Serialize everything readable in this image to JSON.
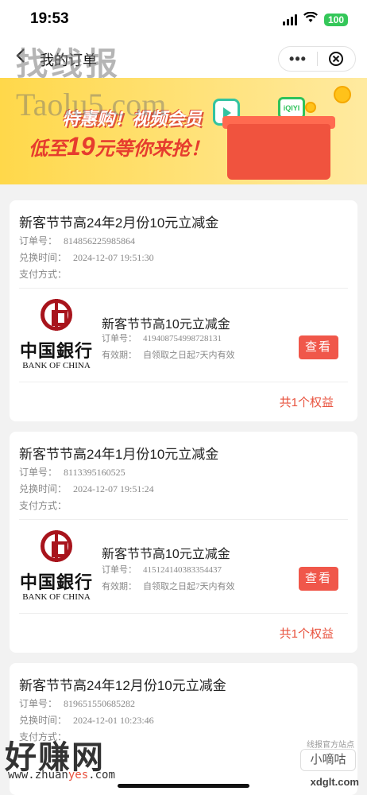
{
  "status": {
    "time": "19:53",
    "battery": "100"
  },
  "nav": {
    "title": "我的订单"
  },
  "watermarks": {
    "top": "找线报",
    "url": "Taolu5.com",
    "bottom": "好赚网",
    "bottom_url_a": "www.zhuan",
    "bottom_url_b": "yes",
    "bottom_url_c": ".com",
    "corner_small": "线报官方站点",
    "corner_box": "小嘀咕",
    "corner_url": "xdglt.com"
  },
  "banner": {
    "line1": "特惠购！视频会员",
    "line2_pre": "低至",
    "line2_num": "19",
    "line2_post": "元等你来抢！",
    "iqiyi": "iQIYI"
  },
  "labels": {
    "order_no": "订单号：",
    "exchange_time": "兑换时间：",
    "pay_method": "支付方式：",
    "coupon_no": "订单号：",
    "validity": "有效期：",
    "view": "查看",
    "bank_cn": "中国銀行",
    "bank_en": "BANK OF CHINA"
  },
  "orders": [
    {
      "title": "新客节节高24年2月份10元立减金",
      "order_no": "814856225985864",
      "time": "2024-12-07 19:51:30",
      "benefit": {
        "name": "新客节节高10元立减金",
        "coupon_no": "419408754998728131",
        "validity": "自领取之日起7天内有效"
      },
      "count": "共1个权益"
    },
    {
      "title": "新客节节高24年1月份10元立减金",
      "order_no": "8113395160525",
      "time": "2024-12-07 19:51:24",
      "benefit": {
        "name": "新客节节高10元立减金",
        "coupon_no": "415124140383354437",
        "validity": "自领取之日起7天内有效"
      },
      "count": "共1个权益"
    },
    {
      "title": "新客节节高24年12月份10元立减金",
      "order_no": "819651550685282",
      "time": "2024-12-01 10:23:46"
    }
  ]
}
